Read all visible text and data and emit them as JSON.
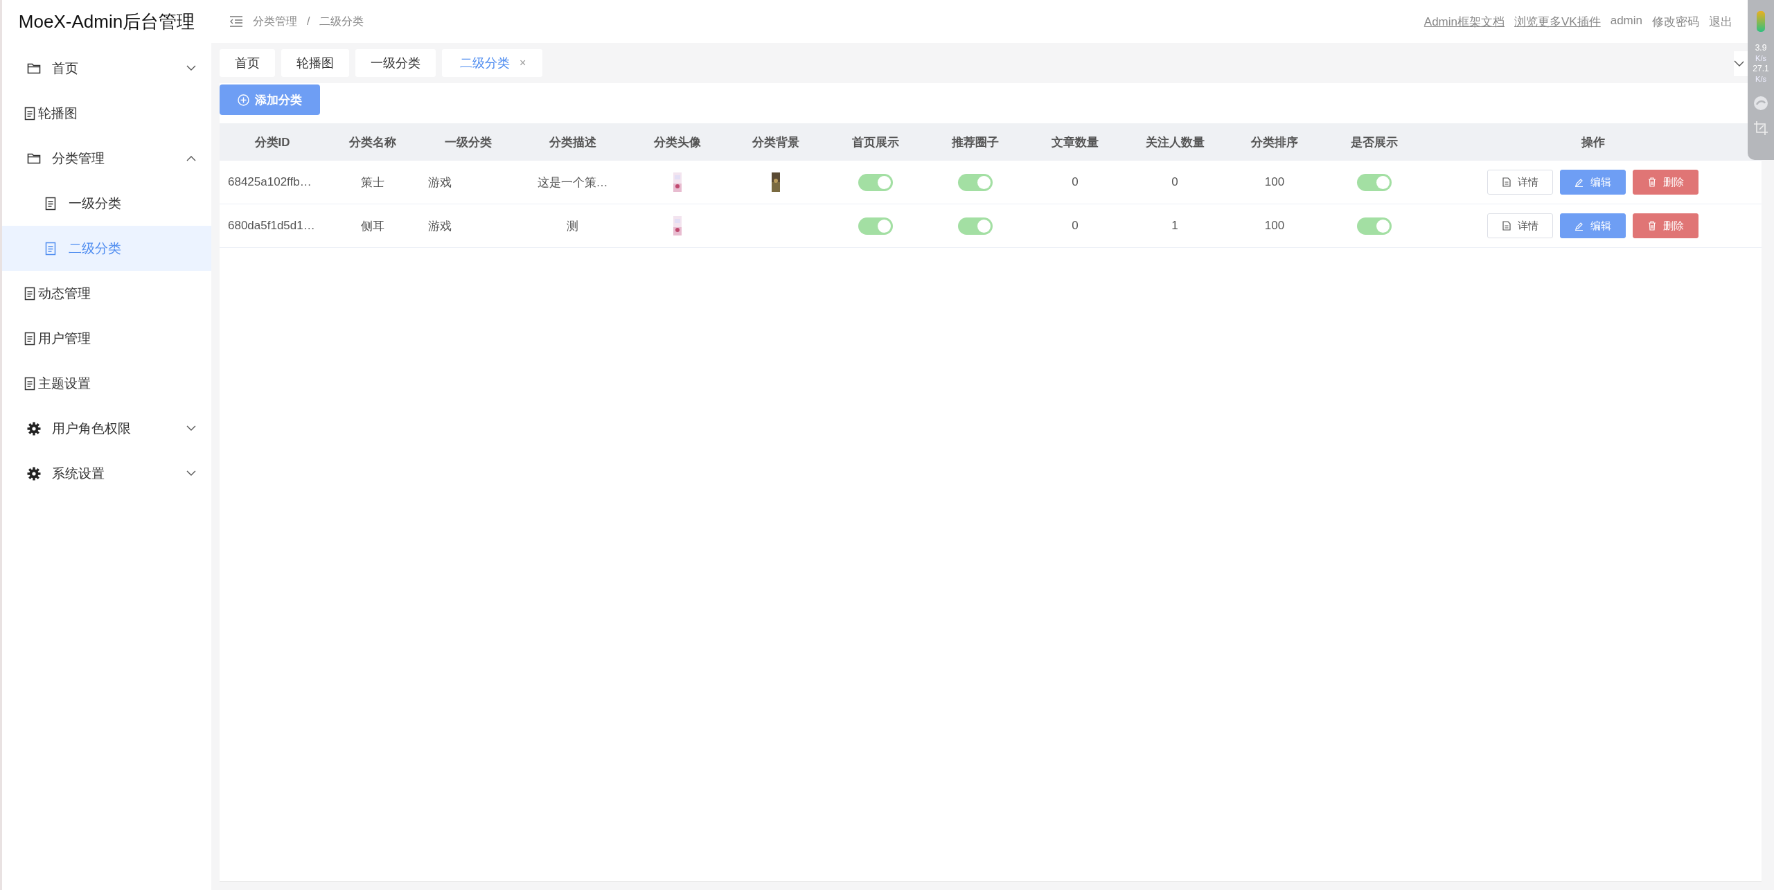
{
  "app": {
    "title": "MoeX-Admin后台管理"
  },
  "sidebar": {
    "items": [
      {
        "label": "首页",
        "kind": "folder",
        "expanded": false,
        "selected": false
      },
      {
        "label": "轮播图",
        "kind": "page",
        "selected": false
      },
      {
        "label": "分类管理",
        "kind": "folder",
        "expanded": true,
        "selected": false,
        "children": [
          {
            "label": "一级分类",
            "kind": "page",
            "selected": false
          },
          {
            "label": "二级分类",
            "kind": "page",
            "selected": true
          }
        ]
      },
      {
        "label": "动态管理",
        "kind": "page",
        "selected": false
      },
      {
        "label": "用户管理",
        "kind": "page",
        "selected": false
      },
      {
        "label": "主题设置",
        "kind": "page",
        "selected": false
      },
      {
        "label": "用户角色权限",
        "kind": "settings",
        "expanded": false,
        "selected": false
      },
      {
        "label": "系统设置",
        "kind": "settings",
        "expanded": false,
        "selected": false
      }
    ]
  },
  "header": {
    "breadcrumb": [
      "分类管理",
      "二级分类"
    ],
    "separator": "/",
    "links": [
      {
        "label": "Admin框架文档",
        "kind": "link"
      },
      {
        "label": "浏览更多VK插件",
        "kind": "link"
      },
      {
        "label": "admin",
        "kind": "text"
      },
      {
        "label": "修改密码",
        "kind": "text"
      },
      {
        "label": "退出",
        "kind": "text"
      }
    ]
  },
  "tabs": [
    {
      "label": "首页",
      "selected": false
    },
    {
      "label": "轮播图",
      "selected": false
    },
    {
      "label": "一级分类",
      "selected": false
    },
    {
      "label": "二级分类",
      "selected": true,
      "close": "×"
    }
  ],
  "add_button": "添加分类",
  "table": {
    "columns": [
      "分类ID",
      "分类名称",
      "一级分类",
      "分类描述",
      "分类头像",
      "分类背景",
      "首页展示",
      "推荐圈子",
      "文章数量",
      "关注人数量",
      "分类排序",
      "是否展示",
      "操作"
    ],
    "rows": [
      {
        "id": "68425a102ffb…",
        "name": "策士",
        "parent": "游戏",
        "description": "这是一个策…",
        "avatar": {
          "kind": "picture"
        },
        "background": {
          "kind": "picture"
        },
        "home_display": {
          "on": true
        },
        "recommend": {
          "on": true
        },
        "articles": "0",
        "followers": "0",
        "order": "100",
        "visible": {
          "on": true
        },
        "actions": [
          {
            "label": "详情",
            "kind": "detail"
          },
          {
            "label": "编辑",
            "kind": "edit"
          },
          {
            "label": "删除",
            "kind": "delete"
          }
        ]
      },
      {
        "id": "680da5f1d5d1…",
        "name": "侧耳",
        "parent": "游戏",
        "description": "测",
        "avatar": {
          "kind": "picture"
        },
        "home_display": {
          "on": true
        },
        "recommend": {
          "on": true
        },
        "articles": "0",
        "followers": "1",
        "order": "100",
        "visible": {
          "on": true
        },
        "actions": [
          {
            "label": "详情",
            "kind": "detail"
          },
          {
            "label": "编辑",
            "kind": "edit"
          },
          {
            "label": "删除",
            "kind": "delete"
          }
        ]
      }
    ]
  },
  "tray_widget": {
    "upload": "3.9",
    "upload_unit": "K/s",
    "download": "27.1",
    "download_unit": "K/s"
  }
}
